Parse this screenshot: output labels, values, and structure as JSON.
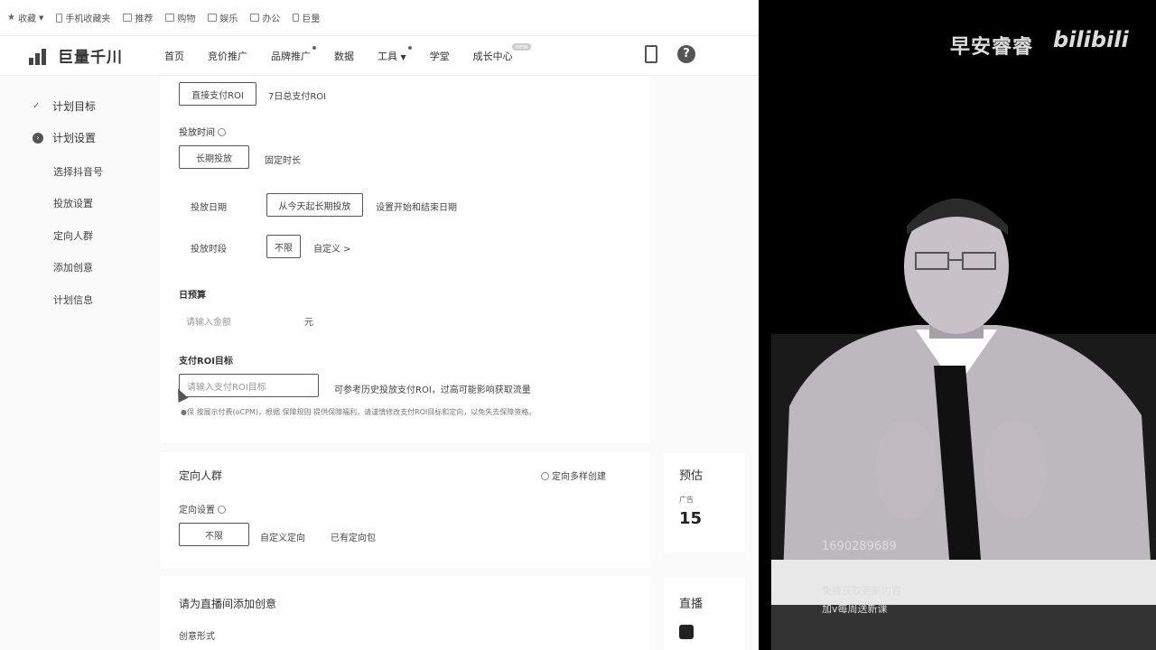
{
  "bookmarks": [
    {
      "label": "收藏",
      "icon": "star-icon"
    },
    {
      "label": "手机收藏夹",
      "icon": "phone-icon"
    },
    {
      "label": "推荐",
      "icon": "folder-icon"
    },
    {
      "label": "购物",
      "icon": "folder-icon"
    },
    {
      "label": "娱乐",
      "icon": "folder-icon"
    },
    {
      "label": "办公",
      "icon": "folder-icon"
    },
    {
      "label": "巨量",
      "icon": "page-icon"
    }
  ],
  "brand": "巨量千川",
  "nav": [
    "首页",
    "竞价推广",
    "品牌推广",
    "数据",
    "工具",
    "学堂",
    "成长中心"
  ],
  "nav_badge": "new",
  "sidebar": {
    "steps": [
      "计划目标",
      "计划设置"
    ],
    "items": [
      "选择抖音号",
      "投放设置",
      "定向人群",
      "添加创意",
      "计划信息"
    ]
  },
  "roi_tabs": [
    "直接支付ROI",
    "7日总支付ROI"
  ],
  "schedule": {
    "title": "投放时间",
    "options": [
      "长期投放",
      "固定时长"
    ],
    "date_label": "投放日期",
    "date_value": "从今天起长期投放",
    "date_link": "设置开始和结束日期",
    "period_label": "投放时段",
    "period_value": "不限",
    "period_link": "自定义 >"
  },
  "budget": {
    "title": "日预算",
    "placeholder": "请输入金额",
    "unit": "元"
  },
  "roi_goal": {
    "title": "支付ROI目标",
    "placeholder": "请输入支付ROI目标",
    "hint": "可参考历史投放支付ROI，过高可能影响获取流量",
    "note": "按展示付费(oCPM)，根据 保障规则 提供保障福利，请谨慎修改支付ROI目标和定向，以免失去保障资格。",
    "note_prefix": "●保"
  },
  "targeting": {
    "title": "定向人群",
    "multi": "定向多样创建",
    "setting_label": "定向设置",
    "options": [
      "不限",
      "自定义定向",
      "已有定向包"
    ]
  },
  "creative": {
    "title": "请为直播间添加创意",
    "sub": "创意形式"
  },
  "right_col": {
    "a_title": "预估",
    "a_sub": "广告",
    "a_num": "15",
    "b_title": "直播"
  },
  "video": {
    "channel": "早安睿睿",
    "platform": "bilibili",
    "captions": [
      "1690289689",
      "免费获取更新内容",
      "加v每周送新课"
    ]
  }
}
